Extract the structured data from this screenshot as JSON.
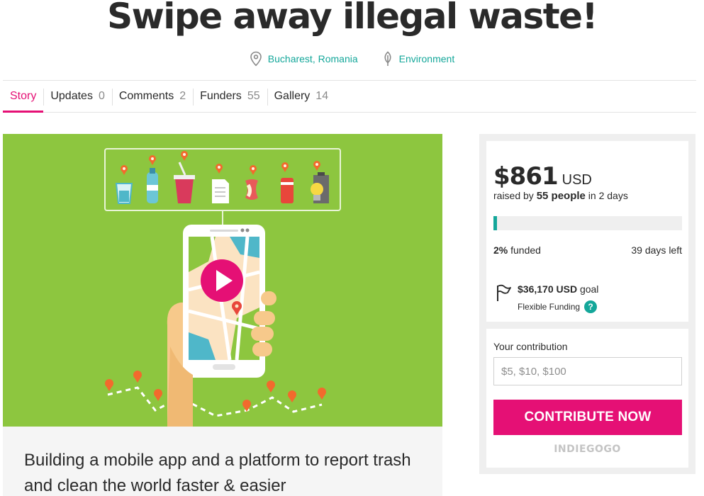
{
  "campaign": {
    "title": "Swipe away illegal waste!",
    "location": "Bucharest, Romania",
    "category": "Environment",
    "tagline": "Building a mobile app and a platform to report trash and clean the world faster & easier"
  },
  "tabs": [
    {
      "label": "Story",
      "count": ""
    },
    {
      "label": "Updates",
      "count": "0"
    },
    {
      "label": "Comments",
      "count": "2"
    },
    {
      "label": "Funders",
      "count": "55"
    },
    {
      "label": "Gallery",
      "count": "14"
    }
  ],
  "funding": {
    "amount": "$861",
    "currency": "USD",
    "raised_prefix": "raised by",
    "people": "55 people",
    "raised_suffix": "in 2 days",
    "percent": "2%",
    "percent_fraction": 0.02,
    "funded_label": "funded",
    "days_left": "39 days left",
    "goal_amount": "$36,170",
    "goal_currency": "USD",
    "goal_label": "goal",
    "funding_type": "Flexible Funding",
    "help_label": "?"
  },
  "contribution": {
    "label": "Your contribution",
    "placeholder": "$5, $10, $100",
    "button_label": "CONTRIBUTE NOW",
    "brand": "INDIEGOGO"
  },
  "colors": {
    "accent_pink": "#e51075",
    "teal": "#14a79a",
    "hero_green": "#8dc63f"
  },
  "icons": [
    "location-pin-icon",
    "leaf-icon",
    "play-icon",
    "flag-icon",
    "help-icon"
  ]
}
